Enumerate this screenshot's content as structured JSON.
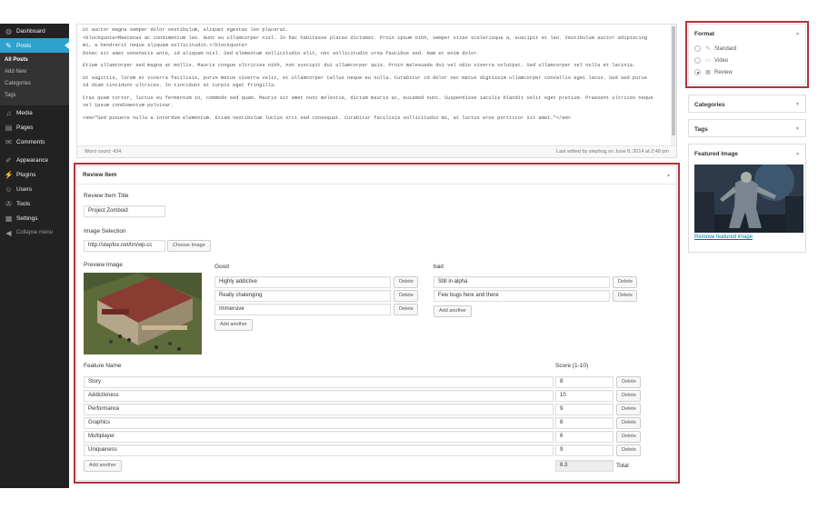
{
  "sidebar": {
    "items": [
      {
        "label": "Dashboard",
        "icon": "dashboard-icon",
        "glyph": "◍"
      },
      {
        "label": "Posts",
        "icon": "pin-icon",
        "glyph": "✎"
      }
    ],
    "posts_submenu": [
      "All Posts",
      "Add New",
      "Categories",
      "Tags"
    ],
    "items2": [
      {
        "label": "Media",
        "icon": "media-icon",
        "glyph": "♫"
      },
      {
        "label": "Pages",
        "icon": "pages-icon",
        "glyph": "▤"
      },
      {
        "label": "Comments",
        "icon": "comments-icon",
        "glyph": "✉"
      }
    ],
    "items3": [
      {
        "label": "Appearance",
        "icon": "brush-icon",
        "glyph": "✐"
      },
      {
        "label": "Plugins",
        "icon": "plug-icon",
        "glyph": "⚡"
      },
      {
        "label": "Users",
        "icon": "users-icon",
        "glyph": "☺"
      },
      {
        "label": "Tools",
        "icon": "wrench-icon",
        "glyph": "✇"
      },
      {
        "label": "Settings",
        "icon": "settings-icon",
        "glyph": "▦"
      }
    ],
    "collapse_label": "Collapse menu"
  },
  "editor": {
    "lines": [
      "Ut auctor magna semper dolor vestibulum, aliquet egestas leo placerat.",
      "<blockquote>Maecenas ac condimentum leo. Nunc eu ullamcorper nisl. In hac habitasse platea dictumst. Proin ipsum nibh, semper vitae scelerisque a, suscipit et leo. Vestibulum auctor adipiscing",
      "mi, a hendrerit neque aliquam sollicitudin.</blockquote>",
      "Donec sit amet venenatis ante, id aliquam nisl. Sed elementum sollicitudin elit, nec sollicitudin urna faucibus sed. Nam et enim dolor.",
      "Etiam ullamcorper sed magna ac mollis. Mauris congue ultricies nibh, non suscipit dui ullamcorper quis. Proin malesuada dui vel odio viverra volutpat. Sed ullamcorper vel nulla et lacinia.",
      "Ut sagittis, lorem et viverra facilisis, purus metus viverra velit, et ullamcorper tellus neque eu nulla. Curabitur id dolor nec metus dignissim ullamcorper convallis eget lacus. Sed sed purus",
      "id diam tincidunt ultrices. In tincidunt at turpis eget fringilla.",
      "Cras quam tortor, luctus eu fermentum in, commodo sed quam. Mauris sit amet nunc molestie, dictum mauris ac, euismod nunc. Suspendisse iaculis blandit velit eget pretium. Praesent ultrices neque",
      "vel ipsum condimentum pulvinar.",
      "<em>\"Sed posuere nulla a interdum elementum. Etiam vestibulum luctus orci sed consequat. Curabitur facilisis sollicitudin mi, at luctus eros porttitor sit amet.\"</em>"
    ],
    "word_count": "Word count: 434",
    "last_edited": "Last edited by stephog on June 8, 2014 at 2:48 pm"
  },
  "review": {
    "header": "Review Item",
    "title_label": "Review Item Title",
    "title_value": "Project Zomboid",
    "image_label": "Image Selection",
    "image_value": "http://stepfox.net/trn/wp-cc",
    "choose_image": "Choose Image",
    "preview_label": "Preview Image",
    "good_label": "Good",
    "good": [
      "Highly addictive",
      "Really chalenging",
      "Immersive"
    ],
    "bad_label": "bad",
    "bad": [
      "Still in alpha",
      "Few bugs here and there"
    ],
    "delete_label": "Delete",
    "add_another": "Add another",
    "feature_label": "Feature Name",
    "score_label": "Score (1-10)",
    "features": [
      {
        "name": "Story",
        "score": "8"
      },
      {
        "name": "Addictivness",
        "score": "10"
      },
      {
        "name": "Performance",
        "score": "9"
      },
      {
        "name": "Graphics",
        "score": "8"
      },
      {
        "name": "Multiplayer",
        "score": "6"
      },
      {
        "name": "Uniqueness",
        "score": "9"
      }
    ],
    "total_value": "8.3",
    "total_label": "Total"
  },
  "format": {
    "title": "Format",
    "options": [
      {
        "label": "Standard",
        "glyph": "✎",
        "checked": false
      },
      {
        "label": "Video",
        "glyph": "▭",
        "checked": false
      },
      {
        "label": "Review",
        "glyph": "▦",
        "checked": true
      }
    ]
  },
  "categories": {
    "title": "Categories"
  },
  "tags": {
    "title": "Tags"
  },
  "featured": {
    "title": "Featured Image",
    "remove_link": "Remove featured image"
  },
  "colors": {
    "accent": "#2ea2cc",
    "sidebar": "#222222",
    "highlight": "#b0323a"
  }
}
